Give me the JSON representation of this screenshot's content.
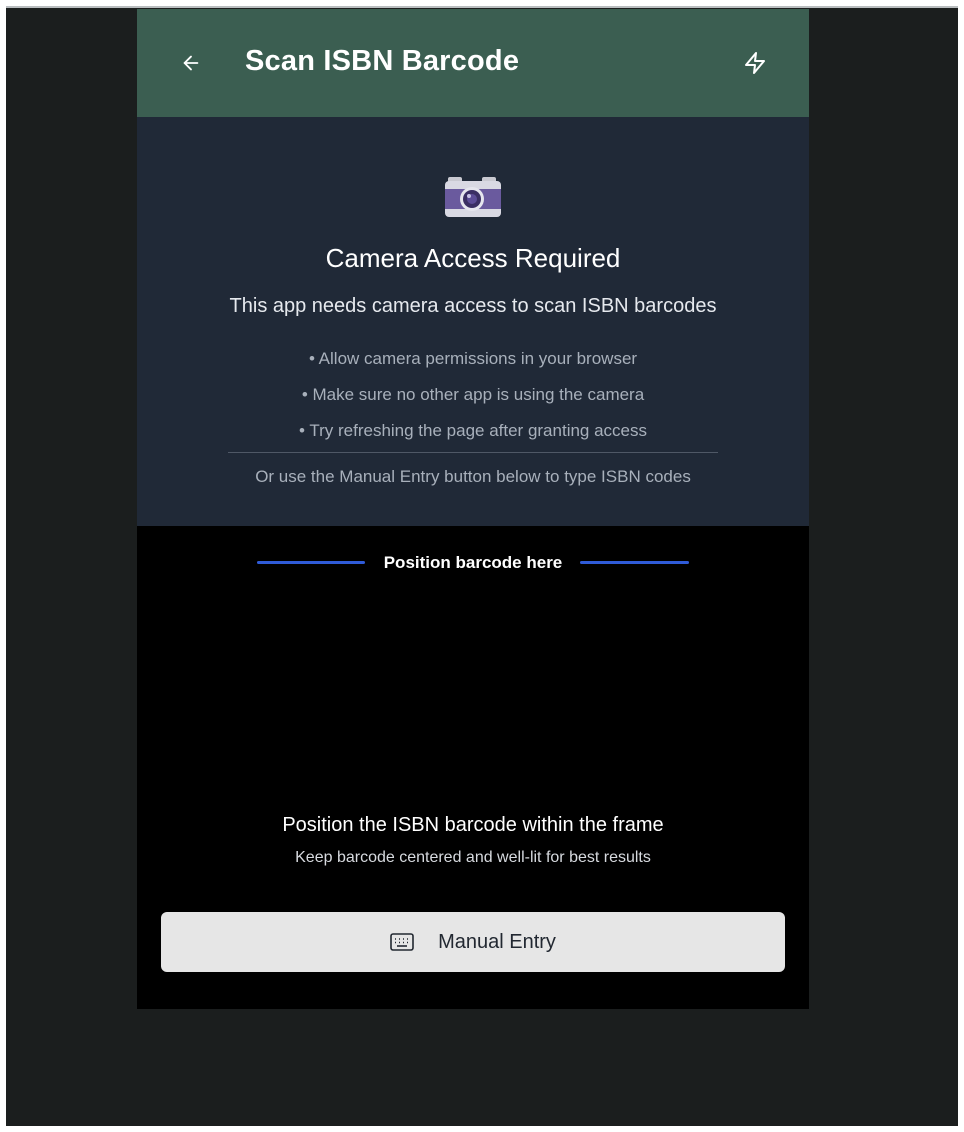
{
  "header": {
    "title": "Scan ISBN Barcode",
    "back_icon": "arrow-left-icon",
    "flash_icon": "lightning-bolt-icon",
    "background": "#3b5e51"
  },
  "notice": {
    "icon": "camera-emoji-icon",
    "title": "Camera Access Required",
    "subtitle": "This app needs camera access to scan ISBN barcodes",
    "tips": [
      "• Allow camera permissions in your browser",
      "• Make sure no other app is using the camera",
      "• Try refreshing the page after granting access"
    ],
    "footer": "Or use the Manual Entry button below to type ISBN codes",
    "background": "#202937"
  },
  "scanner": {
    "frame_label": "Position barcode here",
    "scan_line_color": "#2f5bd8",
    "instruction_title": "Position the ISBN barcode within the frame",
    "instruction_sub": "Keep barcode centered and well-lit for best results"
  },
  "manual_entry": {
    "icon": "keyboard-icon",
    "label": "Manual Entry"
  }
}
